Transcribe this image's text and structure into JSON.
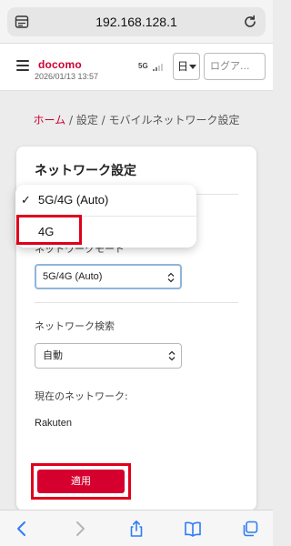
{
  "browser": {
    "url": "192.168.128.1",
    "menu_icon": "page-menu-icon",
    "reload_icon": "reload-icon"
  },
  "header": {
    "brand": "docomo",
    "datetime": "2026/01/13 13:57",
    "network": "5G",
    "language": "日",
    "login": "ログア..."
  },
  "breadcrumb": {
    "home": "ホーム",
    "rest": " / 設定 / モバイルネットワーク設定"
  },
  "card": {
    "title": "ネットワーク設定",
    "network_mode": {
      "label": "ネットワークモード",
      "value": "5G/4G (Auto)"
    },
    "network_search": {
      "label": "ネットワーク検索",
      "value": "自動"
    },
    "current_network": {
      "label": "現在のネットワーク:",
      "value": "Rakuten"
    },
    "apply_label": "適用"
  },
  "dropdown": {
    "options": [
      {
        "label": "5G/4G (Auto)",
        "selected": true
      },
      {
        "label": "4G",
        "selected": false
      }
    ]
  },
  "toolbar": {
    "icons": [
      "back-icon",
      "forward-icon",
      "share-icon",
      "bookmarks-icon",
      "tabs-icon"
    ]
  },
  "colors": {
    "accent": "#cc0033",
    "apply_button": "#d6002f",
    "highlight_frame": "#e0001a",
    "ios_blue": "#2f7cf6"
  }
}
